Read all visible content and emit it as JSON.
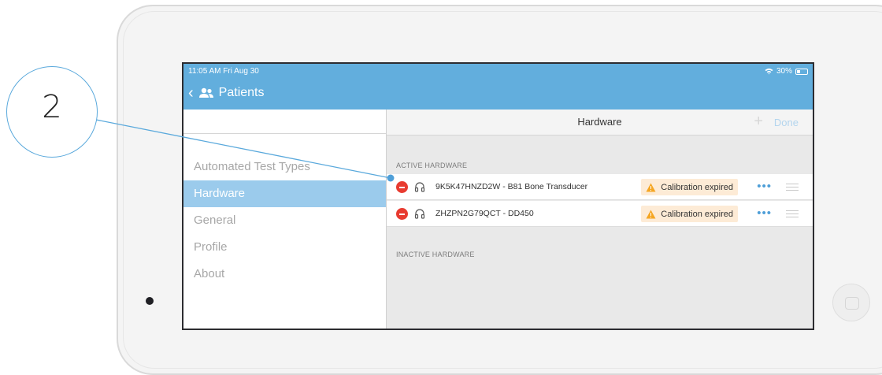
{
  "callout": {
    "number": "2"
  },
  "status_bar": {
    "time": "11:05 AM  Fri Aug 30",
    "battery": "30%",
    "battery_level": 0.3
  },
  "nav": {
    "back_label": "Patients"
  },
  "sidebar": {
    "items": [
      {
        "label": "Automated Test Types",
        "active": false
      },
      {
        "label": "Hardware",
        "active": true
      },
      {
        "label": "General",
        "active": false
      },
      {
        "label": "Profile",
        "active": false
      },
      {
        "label": "About",
        "active": false
      }
    ]
  },
  "detail": {
    "title": "Hardware",
    "add_label": "+",
    "done_label": "Done",
    "active_section": "ACTIVE HARDWARE",
    "inactive_section": "INACTIVE HARDWARE",
    "rows": [
      {
        "name": "9K5K47HNZD2W - B81 Bone Transducer",
        "status": "Calibration expired"
      },
      {
        "name": "ZHZPN2G79QCT - DD450",
        "status": "Calibration expired"
      }
    ],
    "more_label": "•••"
  },
  "colors": {
    "accent": "#62aedd",
    "selected": "#9bcbec",
    "warning": "#f5a623",
    "warning_bg": "#fdebd6",
    "delete": "#e83b30"
  },
  "icons": [
    "users-icon",
    "chevron-left-icon",
    "wifi-icon",
    "battery-icon",
    "minus-circle-icon",
    "headphones-icon",
    "warning-icon",
    "more-icon",
    "drag-handle-icon"
  ]
}
